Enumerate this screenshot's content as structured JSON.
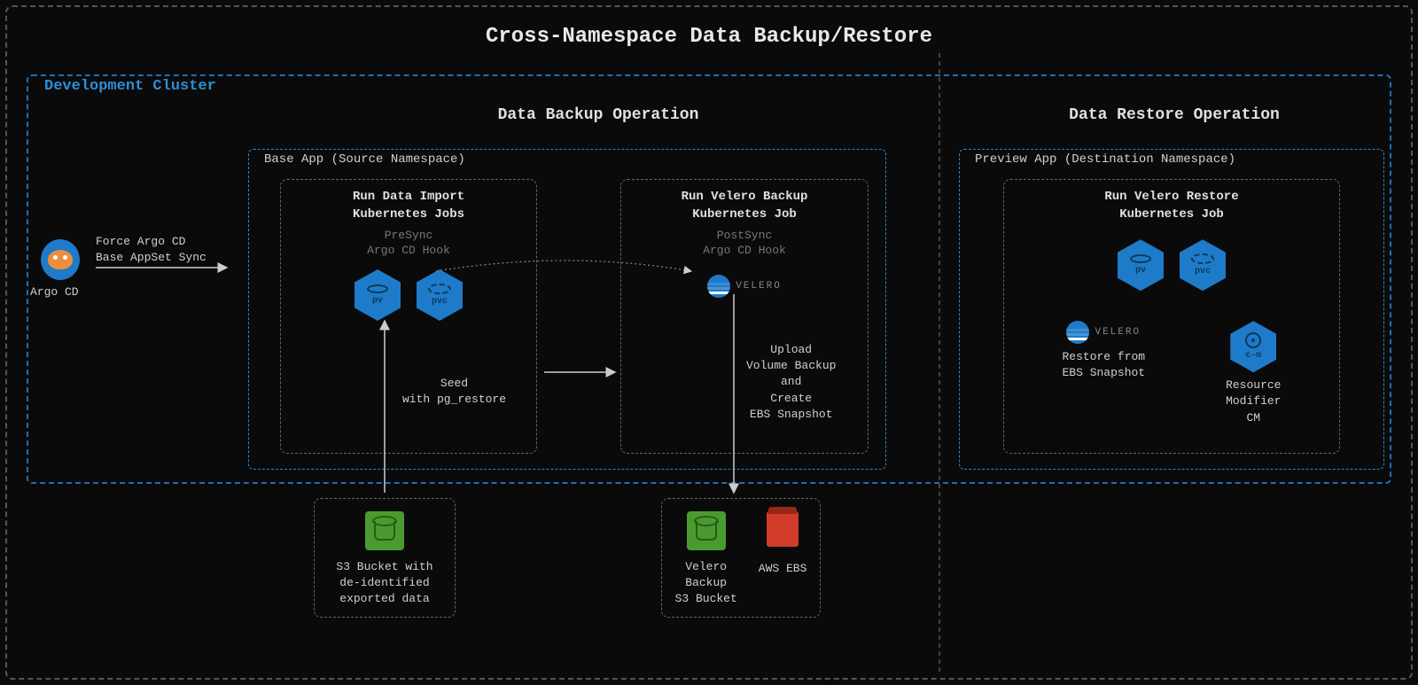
{
  "title": "Cross-Namespace Data Backup/Restore",
  "cluster_label": "Development Cluster",
  "backup_section_title": "Data Backup Operation",
  "restore_section_title": "Data Restore Operation",
  "base_app_label": "Base App (Source Namespace)",
  "preview_app_label": "Preview App (Destination Namespace)",
  "argo": {
    "name": "Argo CD",
    "action_line1": "Force Argo CD",
    "action_line2": "Base AppSet Sync"
  },
  "import_job": {
    "title_line1": "Run Data Import",
    "title_line2": "Kubernetes Jobs",
    "hook_line1": "PreSync",
    "hook_line2": "Argo CD Hook",
    "pv_label": "pv",
    "pvc_label": "pvc",
    "seed_line1": "Seed",
    "seed_line2": "with pg_restore"
  },
  "velero_backup": {
    "title_line1": "Run Velero Backup",
    "title_line2": "Kubernetes Job",
    "hook_line1": "PostSync",
    "hook_line2": "Argo CD Hook",
    "logo_text": "VELERO",
    "upload_line1": "Upload",
    "upload_line2": "Volume Backup",
    "upload_line3": "and",
    "upload_line4": "Create",
    "upload_line5": "EBS Snapshot"
  },
  "velero_restore": {
    "title_line1": "Run Velero Restore",
    "title_line2": "Kubernetes Job",
    "pv_label": "pv",
    "pvc_label": "pvc",
    "logo_text": "VELERO",
    "restore_line1": "Restore from",
    "restore_line2": "EBS Snapshot",
    "cm_label": "c-m",
    "cm_line1": "Resource",
    "cm_line2": "Modifier",
    "cm_line3": "CM"
  },
  "s3_source": {
    "line1": "S3 Bucket with",
    "line2": "de-identified",
    "line3": "exported data"
  },
  "s3_velero": {
    "line1": "Velero",
    "line2": "Backup",
    "line3": "S3 Bucket"
  },
  "ebs_label": "AWS EBS"
}
